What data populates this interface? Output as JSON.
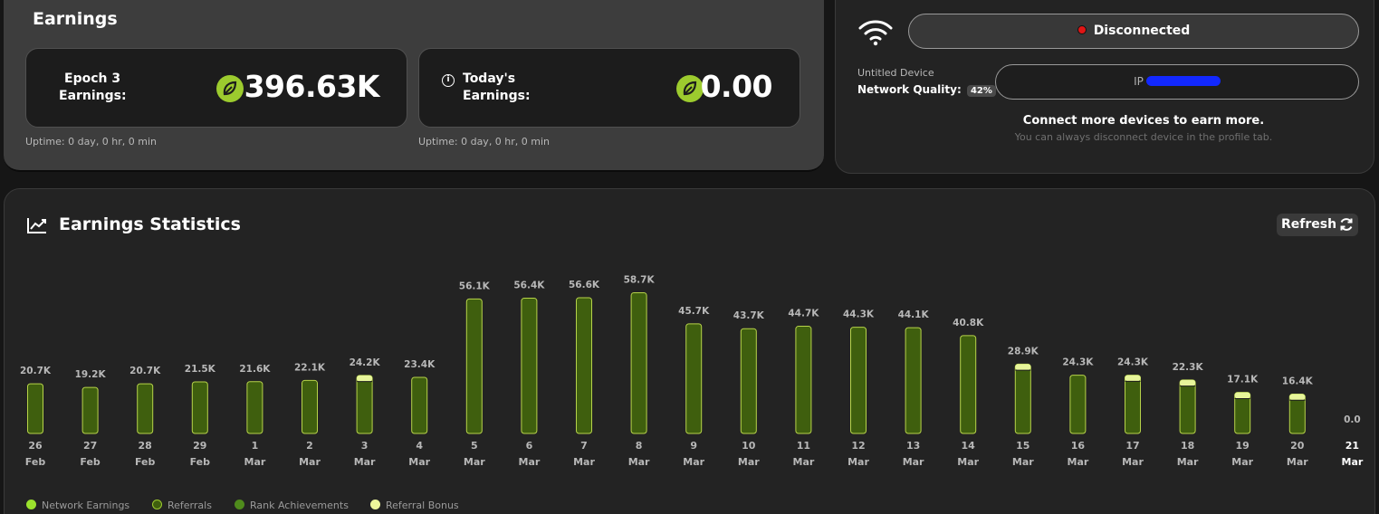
{
  "earnings": {
    "title": "Earnings",
    "epoch_card": {
      "label_line1": "Epoch 3",
      "label_line2": "Earnings:",
      "value": "396.63K",
      "uptime": "Uptime: 0 day, 0 hr, 0 min"
    },
    "today_card": {
      "label_line1": "Today's",
      "label_line2": "Earnings:",
      "value": "0.00",
      "uptime": "Uptime: 0 day, 0 hr, 0 min"
    }
  },
  "device": {
    "status": "Disconnected",
    "name": "Untitled Device",
    "network_quality_label": "Network Quality:",
    "network_quality_value": "42%",
    "ip_label": "IP",
    "connect_more": "Connect more devices to earn more.",
    "disconnect_hint": "You can always disconnect device in the profile tab."
  },
  "stats": {
    "title": "Earnings Statistics",
    "refresh_label": "Refresh"
  },
  "colors": {
    "bar_fill": "#3f5f0e",
    "bar_stroke": "#b7d34a",
    "bonus_cap": "#e7f59a",
    "network_earnings": "#9be22d",
    "referrals": "#3f5f0e",
    "rank_achievements": "#4f8b1c",
    "referral_bonus": "#edf59b",
    "status_red": "#e01515",
    "leaf": "#9ccb2e"
  },
  "chart_data": {
    "type": "bar",
    "categories": [
      [
        "26",
        "Feb"
      ],
      [
        "27",
        "Feb"
      ],
      [
        "28",
        "Feb"
      ],
      [
        "29",
        "Feb"
      ],
      [
        "1",
        "Mar"
      ],
      [
        "2",
        "Mar"
      ],
      [
        "3",
        "Mar"
      ],
      [
        "4",
        "Mar"
      ],
      [
        "5",
        "Mar"
      ],
      [
        "6",
        "Mar"
      ],
      [
        "7",
        "Mar"
      ],
      [
        "8",
        "Mar"
      ],
      [
        "9",
        "Mar"
      ],
      [
        "10",
        "Mar"
      ],
      [
        "11",
        "Mar"
      ],
      [
        "12",
        "Mar"
      ],
      [
        "13",
        "Mar"
      ],
      [
        "14",
        "Mar"
      ],
      [
        "15",
        "Mar"
      ],
      [
        "16",
        "Mar"
      ],
      [
        "17",
        "Mar"
      ],
      [
        "18",
        "Mar"
      ],
      [
        "19",
        "Mar"
      ],
      [
        "20",
        "Mar"
      ],
      [
        "21",
        "Mar"
      ]
    ],
    "value_labels": [
      "20.7K",
      "19.2K",
      "20.7K",
      "21.5K",
      "21.6K",
      "22.1K",
      "24.2K",
      "23.4K",
      "56.1K",
      "56.4K",
      "56.6K",
      "58.7K",
      "45.7K",
      "43.7K",
      "44.7K",
      "44.3K",
      "44.1K",
      "40.8K",
      "28.9K",
      "24.3K",
      "24.3K",
      "22.3K",
      "17.1K",
      "16.4K",
      "0.0"
    ],
    "values": [
      20700,
      19200,
      20700,
      21500,
      21600,
      22100,
      24200,
      23400,
      56100,
      56400,
      56600,
      58700,
      45700,
      43700,
      44700,
      44300,
      44100,
      40800,
      28900,
      24300,
      24300,
      22300,
      17100,
      16400,
      0
    ],
    "referral_bonus": [
      0,
      0,
      0,
      0,
      0,
      0,
      1800,
      0,
      0,
      0,
      0,
      0,
      0,
      0,
      0,
      0,
      0,
      0,
      1800,
      0,
      1800,
      1800,
      1800,
      1800,
      0
    ],
    "legend": [
      "Network Earnings",
      "Referrals",
      "Rank Achievements",
      "Referral Bonus"
    ],
    "ylim": [
      0,
      60000
    ],
    "grid": false,
    "legend_position": "bottom-left"
  }
}
